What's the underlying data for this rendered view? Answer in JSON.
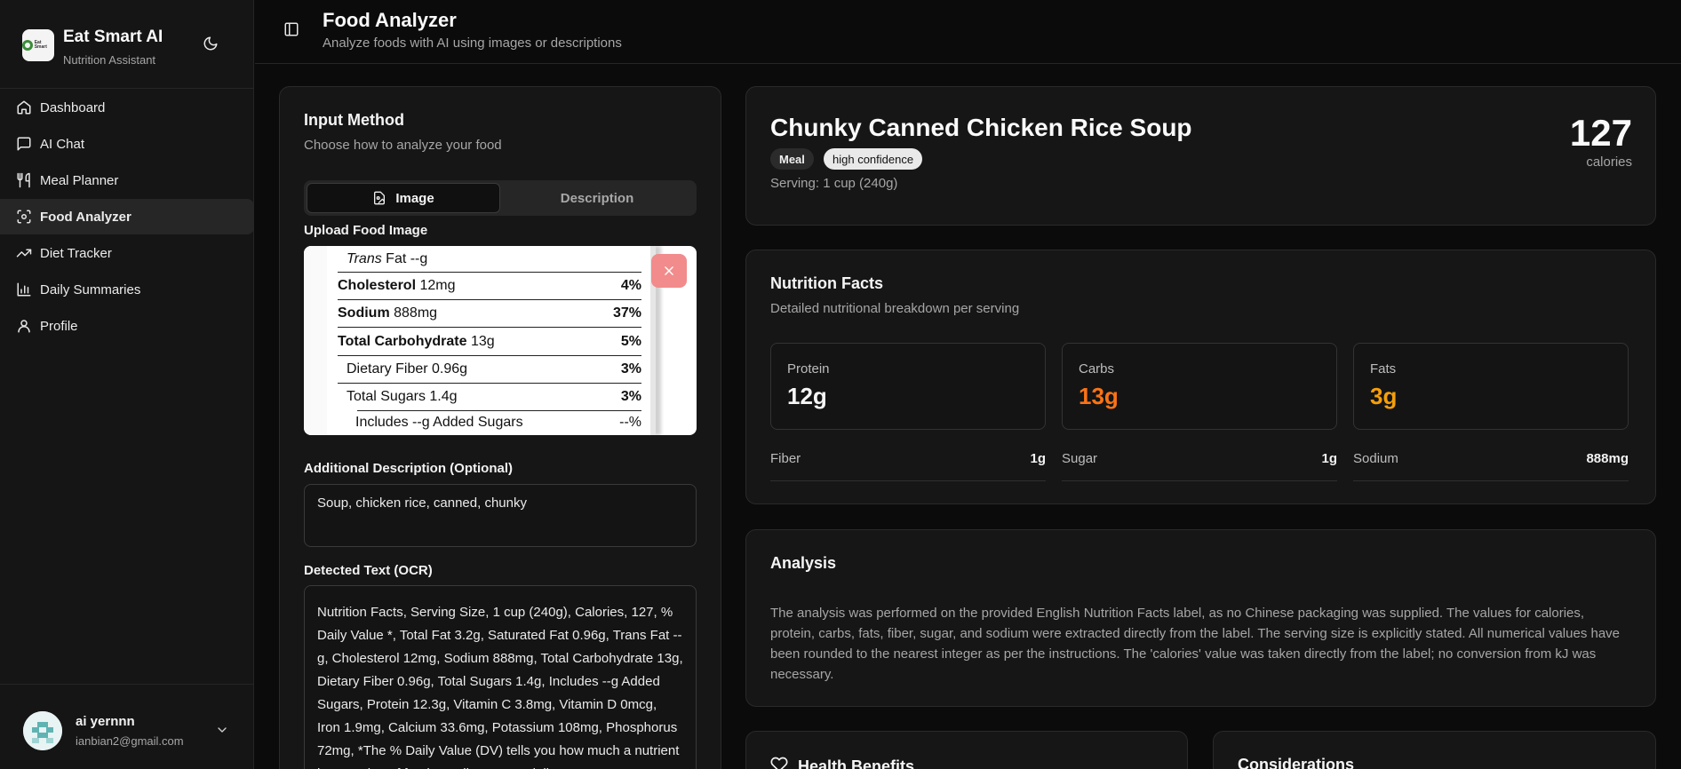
{
  "brand": {
    "title": "Eat Smart AI",
    "subtitle": "Nutrition Assistant",
    "logo_text": "Eat Smart"
  },
  "nav": {
    "items": [
      {
        "label": "Dashboard",
        "icon": "home-icon"
      },
      {
        "label": "AI Chat",
        "icon": "chat-icon"
      },
      {
        "label": "Meal Planner",
        "icon": "utensils-icon"
      },
      {
        "label": "Food Analyzer",
        "icon": "scan-icon",
        "active": true
      },
      {
        "label": "Diet Tracker",
        "icon": "trending-up-icon"
      },
      {
        "label": "Daily Summaries",
        "icon": "bar-chart-icon"
      },
      {
        "label": "Profile",
        "icon": "user-icon"
      }
    ]
  },
  "user": {
    "name": "ai yernnn",
    "email": "ianbian2@gmail.com"
  },
  "header": {
    "title": "Food Analyzer",
    "subtitle": "Analyze foods with AI using images or descriptions"
  },
  "input": {
    "title": "Input Method",
    "subtitle": "Choose how to analyze your food",
    "tabs": {
      "image": "Image",
      "description": "Description"
    },
    "upload_label": "Upload Food Image",
    "desc_label": "Additional Description (Optional)",
    "desc_value": "Soup, chicken rice, canned, chunky",
    "ocr_label": "Detected Text (OCR)",
    "ocr_text": "Nutrition Facts, Serving Size, 1 cup (240g), Calories, 127, % Daily Value *, Total Fat 3.2g, Saturated Fat 0.96g, Trans Fat --g, Cholesterol 12mg, Sodium 888mg, Total Carbohydrate 13g, Dietary Fiber 0.96g, Total Sugars 1.4g, Includes --g Added Sugars, Protein 12.3g, Vitamin C 3.8mg, Vitamin D 0mcg, Iron 1.9mg, Calcium 33.6mg, Potassium 108mg, Phosphorus 72mg, *The % Daily Value (DV) tells you how much a nutrient in a serving of food contributes to a daily"
  },
  "label_image": {
    "rows": [
      {
        "name_italic": "Trans",
        "name": " Fat --g",
        "pct": ""
      },
      {
        "name_bold": "Cholesterol",
        "name": " 12mg",
        "pct": "4%"
      },
      {
        "name_bold": "Sodium",
        "name": " 888mg",
        "pct": "37%"
      },
      {
        "name_bold": "Total Carbohydrate",
        "name": " 13g",
        "pct": "5%"
      },
      {
        "name": "Dietary Fiber 0.96g",
        "pct": "3%"
      },
      {
        "name": "Total Sugars 1.4g",
        "pct": "3%"
      },
      {
        "name": "Includes --g Added Sugars",
        "pct": "--%"
      }
    ]
  },
  "result": {
    "name": "Chunky Canned Chicken Rice Soup",
    "badge_type": "Meal",
    "badge_confidence": "high confidence",
    "serving": "Serving: 1 cup (240g)",
    "calories": "127",
    "calories_label": "calories"
  },
  "nutrition": {
    "title": "Nutrition Facts",
    "subtitle": "Detailed nutritional breakdown per serving",
    "macros": [
      {
        "name": "Protein",
        "value": "12g",
        "color": "#f5f5f5"
      },
      {
        "name": "Carbs",
        "value": "13g",
        "color": "#f97316"
      },
      {
        "name": "Fats",
        "value": "3g",
        "color": "#f59e0b"
      }
    ],
    "minors": [
      {
        "name": "Fiber",
        "value": "1g"
      },
      {
        "name": "Sugar",
        "value": "1g"
      },
      {
        "name": "Sodium",
        "value": "888mg"
      }
    ]
  },
  "analysis": {
    "title": "Analysis",
    "text": "The analysis was performed on the provided English Nutrition Facts label, as no Chinese packaging was supplied. The values for calories, protein, carbs, fats, fiber, sugar, and sodium were extracted directly from the label. The serving size is explicitly stated. All numerical values have been rounded to the nearest integer as per the instructions. The 'calories' value was taken directly from the label; no conversion from kJ was necessary."
  },
  "health": {
    "title": "Health Benefits"
  },
  "considerations": {
    "title": "Considerations"
  }
}
